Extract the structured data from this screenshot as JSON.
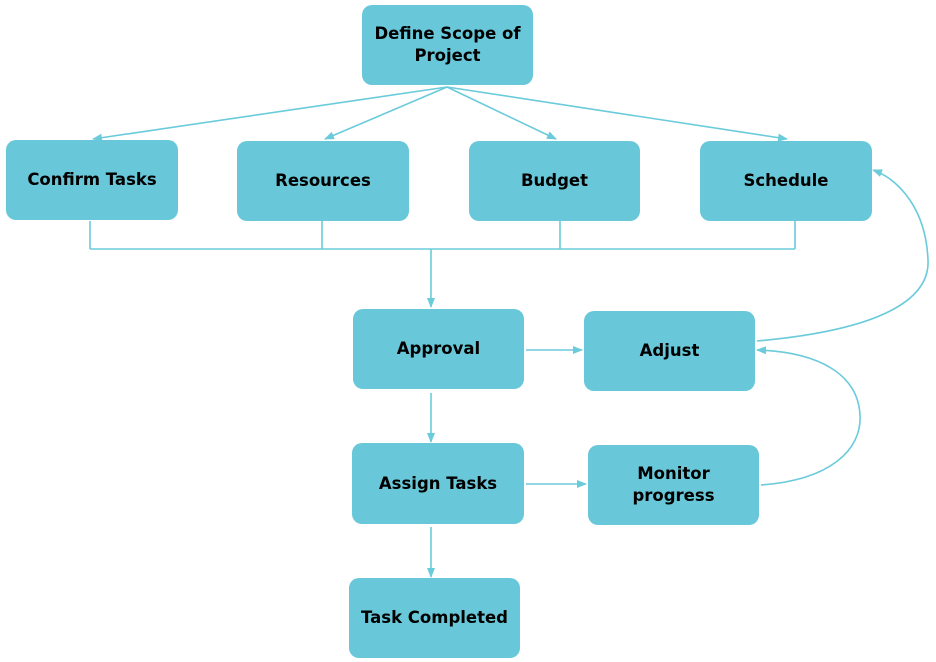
{
  "colors": {
    "node_fill": "#68C8D9",
    "connector": "#6ACBDB"
  },
  "nodes": {
    "define_scope": "Define Scope of Project",
    "confirm_tasks": "Confirm Tasks",
    "resources": "Resources",
    "budget": "Budget",
    "schedule": "Schedule",
    "approval": "Approval",
    "adjust": "Adjust",
    "assign_tasks": "Assign Tasks",
    "monitor_progress": "Monitor progress",
    "task_completed": "Task Completed"
  }
}
